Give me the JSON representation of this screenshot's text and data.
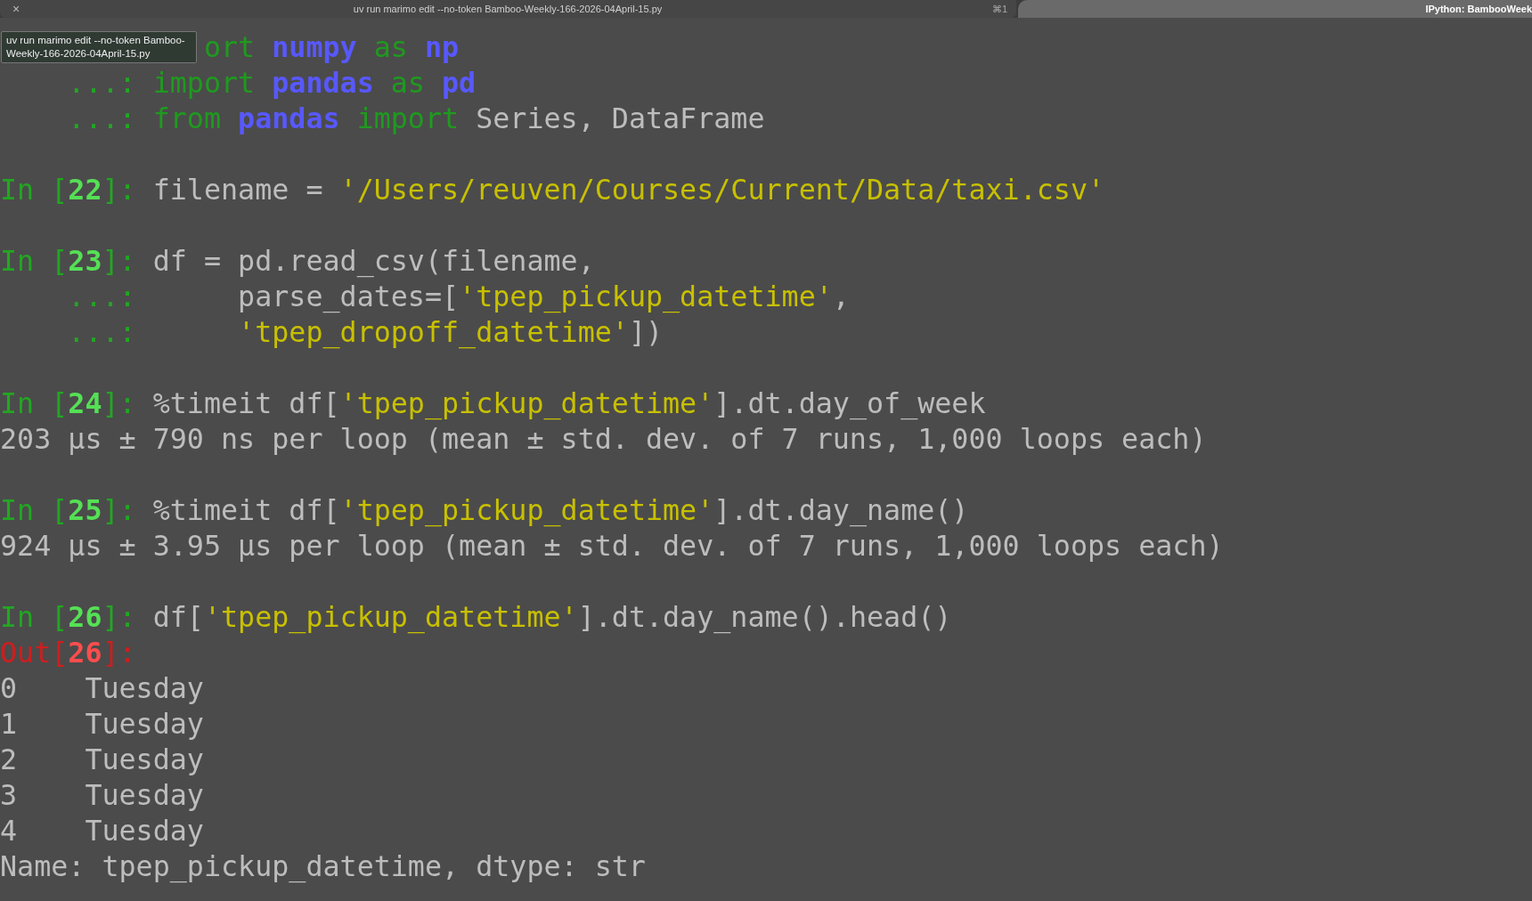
{
  "tabs": [
    {
      "title": "uv run marimo edit --no-token Bamboo-Weekly-166-2026-04April-15.py",
      "close": "×",
      "shortcut": "⌘1",
      "selected": false
    },
    {
      "title": "IPython: BambooWeek",
      "selected": true
    }
  ],
  "tooltip": "uv run marimo edit --no-token Bamboo-Weekly-166-2026-04April-15.py",
  "lines": [
    {
      "kind": "covered",
      "tokens": [
        {
          "kind": "keyword",
          "text": "ort"
        },
        {
          "kind": "module",
          "text": " numpy"
        },
        {
          "kind": "keyword",
          "text": " as"
        },
        {
          "kind": "module",
          "text": " np"
        }
      ]
    },
    {
      "kind": "code",
      "tokens": [
        {
          "kind": "prompt",
          "text": "    ...:"
        },
        {
          "kind": "keyword",
          "text": " import"
        },
        {
          "kind": "module",
          "text": " pandas"
        },
        {
          "kind": "keyword",
          "text": " as"
        },
        {
          "kind": "module",
          "text": " pd"
        }
      ]
    },
    {
      "kind": "code",
      "tokens": [
        {
          "kind": "prompt",
          "text": "    ...:"
        },
        {
          "kind": "keyword",
          "text": " from"
        },
        {
          "kind": "module",
          "text": " pandas"
        },
        {
          "kind": "keyword",
          "text": " import"
        },
        {
          "kind": "plain",
          "text": " Series, DataFrame"
        }
      ]
    },
    {
      "kind": "blank"
    },
    {
      "kind": "code",
      "tokens": [
        {
          "kind": "prompt",
          "text": "In ["
        },
        {
          "kind": "number",
          "text": "22"
        },
        {
          "kind": "prompt",
          "text": "]:"
        },
        {
          "kind": "plain",
          "text": " filename ="
        },
        {
          "kind": "string",
          "text": " '/Users/reuven/Courses/Current/Data/taxi.csv'"
        }
      ]
    },
    {
      "kind": "blank"
    },
    {
      "kind": "code",
      "tokens": [
        {
          "kind": "prompt",
          "text": "In ["
        },
        {
          "kind": "number",
          "text": "23"
        },
        {
          "kind": "prompt",
          "text": "]:"
        },
        {
          "kind": "plain",
          "text": " df = pd.read_csv(filename,"
        }
      ]
    },
    {
      "kind": "code",
      "tokens": [
        {
          "kind": "prompt",
          "text": "    ...:"
        },
        {
          "kind": "plain",
          "text": "      parse_dates=["
        },
        {
          "kind": "string",
          "text": "'tpep_pickup_datetime'"
        },
        {
          "kind": "plain",
          "text": ","
        }
      ]
    },
    {
      "kind": "code",
      "tokens": [
        {
          "kind": "prompt",
          "text": "    ...:"
        },
        {
          "kind": "string",
          "text": "      'tpep_dropoff_datetime'"
        },
        {
          "kind": "plain",
          "text": "])"
        }
      ]
    },
    {
      "kind": "blank"
    },
    {
      "kind": "code",
      "tokens": [
        {
          "kind": "prompt",
          "text": "In ["
        },
        {
          "kind": "number",
          "text": "24"
        },
        {
          "kind": "prompt",
          "text": "]:"
        },
        {
          "kind": "plain",
          "text": " %timeit df["
        },
        {
          "kind": "string",
          "text": "'tpep_pickup_datetime'"
        },
        {
          "kind": "plain",
          "text": "].dt.day_of_week"
        }
      ]
    },
    {
      "kind": "code",
      "tokens": [
        {
          "kind": "plain",
          "text": "203 µs ± 790 ns per loop (mean ± std. dev. of 7 runs, 1,000 loops each)"
        }
      ]
    },
    {
      "kind": "blank"
    },
    {
      "kind": "code",
      "tokens": [
        {
          "kind": "prompt",
          "text": "In ["
        },
        {
          "kind": "number",
          "text": "25"
        },
        {
          "kind": "prompt",
          "text": "]:"
        },
        {
          "kind": "plain",
          "text": " %timeit df["
        },
        {
          "kind": "string",
          "text": "'tpep_pickup_datetime'"
        },
        {
          "kind": "plain",
          "text": "].dt.day_name()"
        }
      ]
    },
    {
      "kind": "code",
      "tokens": [
        {
          "kind": "plain",
          "text": "924 µs ± 3.95 µs per loop (mean ± std. dev. of 7 runs, 1,000 loops each)"
        }
      ]
    },
    {
      "kind": "blank"
    },
    {
      "kind": "code",
      "tokens": [
        {
          "kind": "prompt",
          "text": "In ["
        },
        {
          "kind": "number",
          "text": "26"
        },
        {
          "kind": "prompt",
          "text": "]:"
        },
        {
          "kind": "plain",
          "text": " df["
        },
        {
          "kind": "string",
          "text": "'tpep_pickup_datetime'"
        },
        {
          "kind": "plain",
          "text": "].dt.day_name().head()"
        }
      ]
    },
    {
      "kind": "code",
      "tokens": [
        {
          "kind": "out",
          "text": "Out["
        },
        {
          "kind": "outnumber",
          "text": "26"
        },
        {
          "kind": "out",
          "text": "]:"
        }
      ]
    },
    {
      "kind": "code",
      "tokens": [
        {
          "kind": "plain",
          "text": "0    Tuesday"
        }
      ]
    },
    {
      "kind": "code",
      "tokens": [
        {
          "kind": "plain",
          "text": "1    Tuesday"
        }
      ]
    },
    {
      "kind": "code",
      "tokens": [
        {
          "kind": "plain",
          "text": "2    Tuesday"
        }
      ]
    },
    {
      "kind": "code",
      "tokens": [
        {
          "kind": "plain",
          "text": "3    Tuesday"
        }
      ]
    },
    {
      "kind": "code",
      "tokens": [
        {
          "kind": "plain",
          "text": "4    Tuesday"
        }
      ]
    },
    {
      "kind": "code",
      "tokens": [
        {
          "kind": "plain",
          "text": "Name: tpep_pickup_datetime, dtype: str"
        }
      ]
    }
  ]
}
